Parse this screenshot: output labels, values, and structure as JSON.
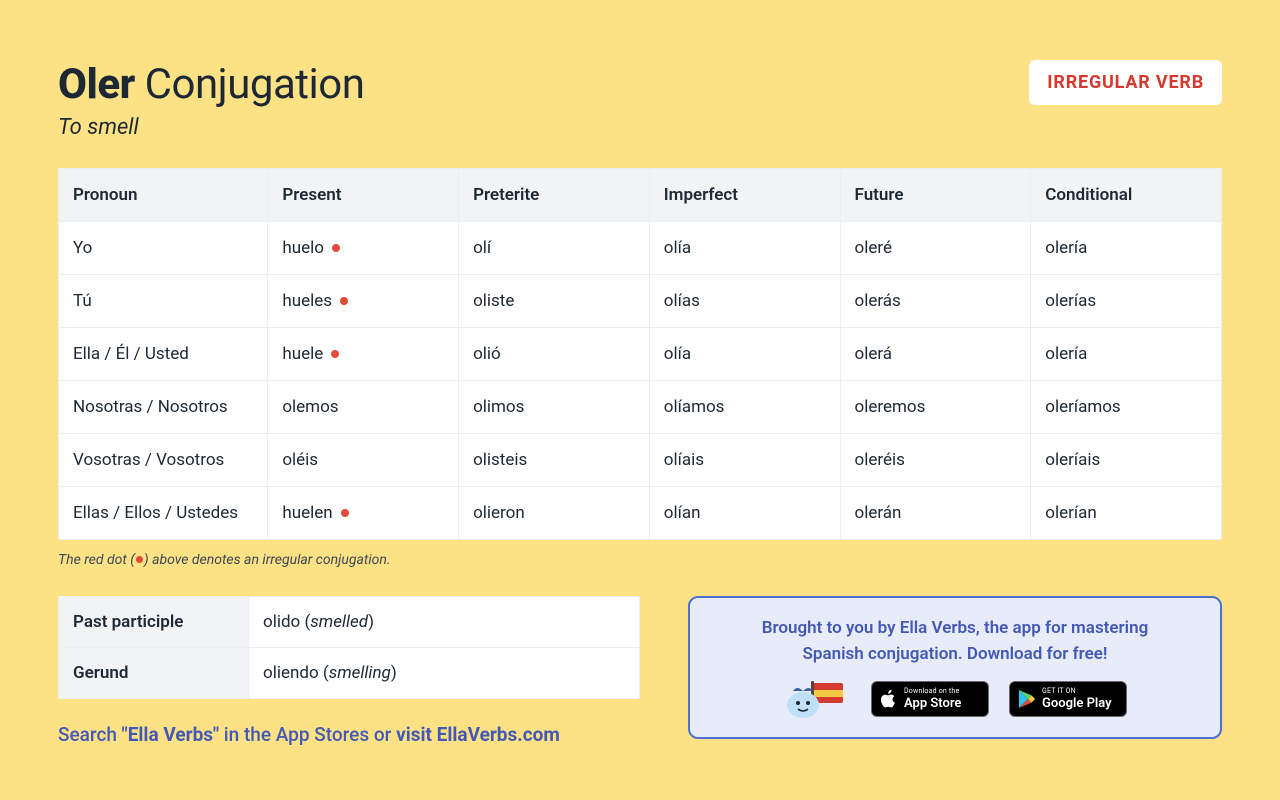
{
  "header": {
    "verb": "Oler",
    "title_suffix": "Conjugation",
    "translation": "To smell",
    "badge": "IRREGULAR VERB"
  },
  "table": {
    "headers": [
      "Pronoun",
      "Present",
      "Preterite",
      "Imperfect",
      "Future",
      "Conditional"
    ],
    "rows": [
      {
        "pronoun": "Yo",
        "cells": [
          {
            "text": "huelo",
            "irregular": true
          },
          {
            "text": "olí",
            "irregular": false
          },
          {
            "text": "olía",
            "irregular": false
          },
          {
            "text": "oleré",
            "irregular": false
          },
          {
            "text": "olería",
            "irregular": false
          }
        ]
      },
      {
        "pronoun": "Tú",
        "cells": [
          {
            "text": "hueles",
            "irregular": true
          },
          {
            "text": "oliste",
            "irregular": false
          },
          {
            "text": "olías",
            "irregular": false
          },
          {
            "text": "olerás",
            "irregular": false
          },
          {
            "text": "olerías",
            "irregular": false
          }
        ]
      },
      {
        "pronoun": "Ella / Él / Usted",
        "cells": [
          {
            "text": "huele",
            "irregular": true
          },
          {
            "text": "olió",
            "irregular": false
          },
          {
            "text": "olía",
            "irregular": false
          },
          {
            "text": "olerá",
            "irregular": false
          },
          {
            "text": "olería",
            "irregular": false
          }
        ]
      },
      {
        "pronoun": "Nosotras / Nosotros",
        "cells": [
          {
            "text": "olemos",
            "irregular": false
          },
          {
            "text": "olimos",
            "irregular": false
          },
          {
            "text": "olíamos",
            "irregular": false
          },
          {
            "text": "oleremos",
            "irregular": false
          },
          {
            "text": "oleríamos",
            "irregular": false
          }
        ]
      },
      {
        "pronoun": "Vosotras / Vosotros",
        "cells": [
          {
            "text": "oléis",
            "irregular": false
          },
          {
            "text": "olisteis",
            "irregular": false
          },
          {
            "text": "olíais",
            "irregular": false
          },
          {
            "text": "oleréis",
            "irregular": false
          },
          {
            "text": "oleríais",
            "irregular": false
          }
        ]
      },
      {
        "pronoun": "Ellas / Ellos / Ustedes",
        "cells": [
          {
            "text": "huelen",
            "irregular": true
          },
          {
            "text": "olieron",
            "irregular": false
          },
          {
            "text": "olían",
            "irregular": false
          },
          {
            "text": "olerán",
            "irregular": false
          },
          {
            "text": "olerían",
            "irregular": false
          }
        ]
      }
    ]
  },
  "note": {
    "before": "The red dot (",
    "after": ") above denotes an irregular conjugation."
  },
  "forms": {
    "past_participle": {
      "label": "Past participle",
      "value": "olido",
      "gloss": "smelled"
    },
    "gerund": {
      "label": "Gerund",
      "value": "oliendo",
      "gloss": "smelling"
    }
  },
  "search_line": {
    "prefix": "Search ",
    "query": "\"Ella Verbs\"",
    "mid": " in the App Stores or ",
    "link": "visit EllaVerbs.com"
  },
  "promo": {
    "line1": "Brought to you by Ella Verbs, the app for mastering",
    "line2": "Spanish conjugation. Download for free!",
    "appstore": {
      "small": "Download on the",
      "big": "App Store"
    },
    "play": {
      "small": "GET IT ON",
      "big": "Google Play"
    }
  }
}
